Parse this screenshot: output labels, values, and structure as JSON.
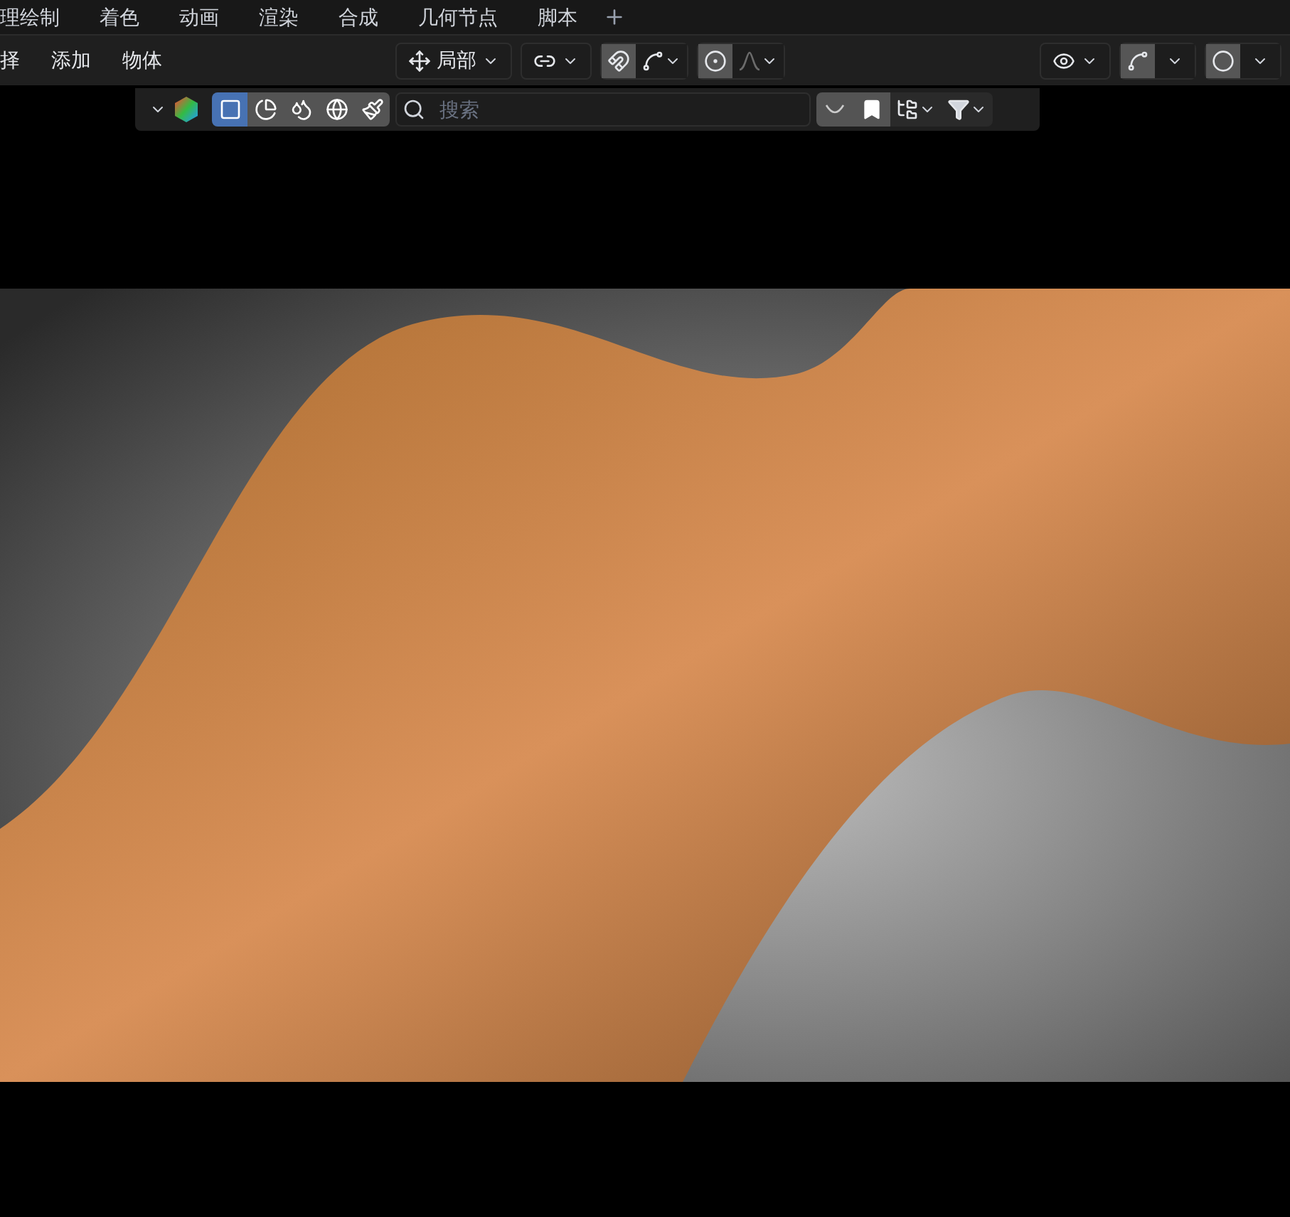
{
  "workspace_tabs": [
    {
      "label": "理绘制",
      "selected": false
    },
    {
      "label": "着色",
      "selected": false
    },
    {
      "label": "动画",
      "selected": false
    },
    {
      "label": "渲染",
      "selected": false
    },
    {
      "label": "合成",
      "selected": false
    },
    {
      "label": "几何节点",
      "selected": false
    },
    {
      "label": "脚本",
      "selected": false
    }
  ],
  "menu": [
    "择",
    "添加",
    "物体"
  ],
  "header": {
    "orientation": "局部",
    "snap_on": true,
    "proportional_on": true,
    "gizmo_on": true,
    "overlay_on": true
  },
  "outliner_bar": {
    "filter_buttons": [
      {
        "selected": true
      },
      {
        "selected": false
      },
      {
        "selected": false
      },
      {
        "selected": false
      },
      {
        "selected": false
      }
    ],
    "search": {
      "placeholder": "搜索"
    },
    "bookmark_on": true
  }
}
